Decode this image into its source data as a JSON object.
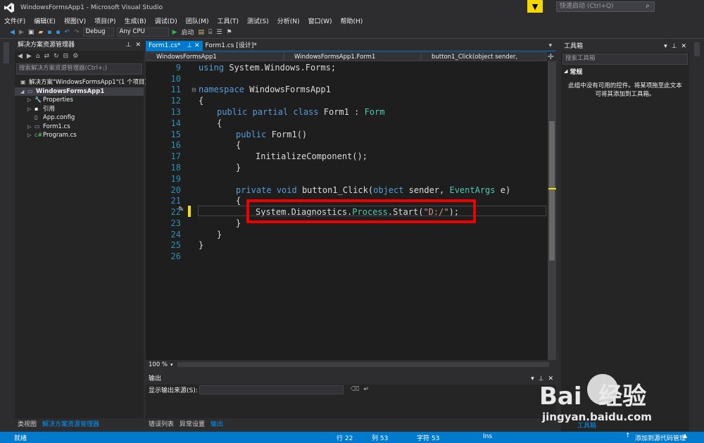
{
  "window": {
    "title": "WindowsFormsApp1 - Microsoft Visual Studio",
    "quick_launch_placeholder": "快速启动 (Ctrl+Q)",
    "minimize": "—",
    "maximize": "☐",
    "close": "✕"
  },
  "menu": [
    "文件(F)",
    "编辑(E)",
    "视图(V)",
    "项目(P)",
    "生成(B)",
    "调试(D)",
    "团队(M)",
    "工具(T)",
    "测试(S)",
    "分析(N)",
    "窗口(W)",
    "帮助(H)"
  ],
  "toolbar": {
    "config": "Debug",
    "platform": "Any CPU",
    "start_label": "启动"
  },
  "solution_explorer": {
    "title": "解决方案资源管理器",
    "search_placeholder": "搜索解决方案资源管理器(Ctrl+;)",
    "items": [
      {
        "label": "解决方案\"WindowsFormsApp1\"(1 个项目)"
      },
      {
        "label": "WindowsFormsApp1"
      },
      {
        "label": "Properties"
      },
      {
        "label": "引用"
      },
      {
        "label": "App.config"
      },
      {
        "label": "Form1.cs"
      },
      {
        "label": "Program.cs"
      }
    ],
    "bottom_tabs": [
      "类视图",
      "解决方案资源管理器"
    ]
  },
  "editor": {
    "tabs": [
      "Form1.cs*",
      "Form1.cs [设计]*"
    ],
    "nav": [
      "WindowsFormsApp1",
      "WindowsFormsApp1.Form1",
      "button1_Click(object sender, EventArgs e)"
    ],
    "line_numbers": [
      "9",
      "10",
      "11",
      "12",
      "13",
      "14",
      "15",
      "16",
      "17",
      "18",
      "19",
      "20",
      "21",
      "22",
      "23",
      "24",
      "25",
      "26"
    ],
    "lines": {
      "l9_a": "using",
      "l9_b": " System.Windows.Forms;",
      "l11_a": "namespace",
      "l11_b": " WindowsFormsApp1",
      "l12": "{",
      "l13_a": "public",
      "l13_b": "partial",
      "l13_c": "class",
      "l13_d": " Form1 : ",
      "l13_e": "Form",
      "l14": "{",
      "l15_a": "public",
      "l15_b": " Form1()",
      "l16": "{",
      "l17": "InitializeComponent();",
      "l18": "}",
      "l20_a": "private",
      "l20_b": "void",
      "l20_c": " button1_Click(",
      "l20_d": "object",
      "l20_e": " sender, ",
      "l20_f": "EventArgs",
      "l20_g": " e)",
      "l21": "{",
      "l22_a": "System.Diagnostics.",
      "l22_b": "Process",
      "l22_c": ".Start(",
      "l22_d": "\"D:/\"",
      "l22_e": ");",
      "l23": "}",
      "l24": "}",
      "l25": "}"
    },
    "zoom": "100 %"
  },
  "output": {
    "title": "输出",
    "source_label": "显示输出来源(S):",
    "bottom_tabs": [
      "错误列表",
      "异常设置",
      "输出"
    ]
  },
  "toolbox": {
    "title": "工具箱",
    "search_placeholder": "搜索工具箱",
    "group": "常规",
    "empty_text": "此组中没有可用的控件。将某项拖至此文本可将其添加到工具箱。"
  },
  "right_tabs": [
    "工具箱"
  ],
  "status": {
    "ready": "就绪",
    "line": "行 22",
    "col": "列 53",
    "char": "字符 53",
    "ins": "Ins",
    "source_control": "添加到源代码管理"
  },
  "watermark": {
    "brand": "Bai  经验",
    "url": "jingyan.baidu.com"
  }
}
